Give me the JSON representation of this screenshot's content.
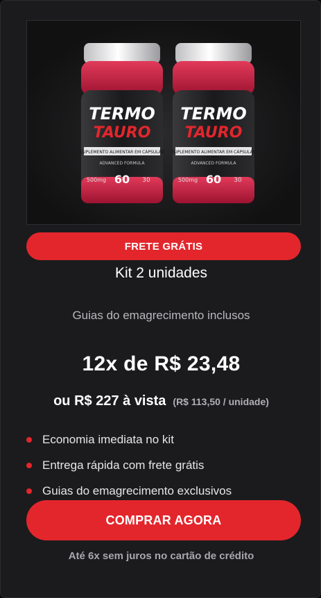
{
  "product": {
    "image_alt": "Termo Tauro",
    "label_line1": "TERMO",
    "label_line2": "TAURO",
    "strip_text": "SUPLEMENTO ALIMENTAR EM CÁPSULAS",
    "formula_text": "ADVANCED FORMULA",
    "dose_text": "500mg",
    "caps_count": "60",
    "days_text": "30"
  },
  "colors": {
    "accent": "#e3262c",
    "card_bg": "#1b1b1d"
  },
  "offer": {
    "badge": "FRETE GRÁTIS",
    "kit_title": "Kit 2 unidades",
    "subtitle": "Guias do emagrecimento inclusos",
    "installment": "12x de R$ 23,48",
    "cash_price": "ou R$ 227 à vista",
    "per_unit": "(R$ 113,50 / unidade)",
    "benefits": [
      "Economia imediata no kit",
      "Entrega rápida com frete grátis",
      "Guias do emagrecimento exclusivos"
    ],
    "cta": "COMPRAR AGORA",
    "footnote": "Até 6x sem juros no cartão de crédito"
  }
}
